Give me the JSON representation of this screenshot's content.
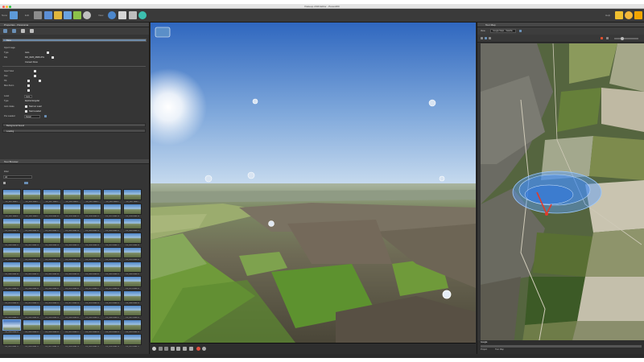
{
  "window": {
    "title": "Pasteup 2019 Editor - Panos360"
  },
  "toolbar": {
    "left_label": "Nano",
    "edit_label": "Edit",
    "view_label": "View",
    "right_label": "Help"
  },
  "properties": {
    "title": "Properties - Panorama",
    "name_value": "Base",
    "input_image_label": "Input Image",
    "type_label": "Type",
    "type_value": "Auto",
    "file_label": "File",
    "file_value": "DJI_0025_0808.JPG",
    "convert_label": "Convert Pano",
    "input_view_label": "Input View",
    "pan_label": "Pan",
    "tilt_label": "Tilt",
    "fov_label": "Max Zoom",
    "level_label": "Level",
    "level_value": "Auto",
    "type2_label": "Type",
    "type2_value": "Equirectangular",
    "auto_label": "Auto rotate",
    "startload": "Start on Load",
    "startnext": "Start Loaded",
    "overlay_label": "Pre Loaded",
    "overlay_value": "Detail",
    "section1": "Background Sound",
    "section2": "Loading"
  },
  "tour_browser": {
    "title": "Tour Browser",
    "filter_label": "Filter",
    "filter_value": "All",
    "thumbs": [
      "DJI_0025 Node 1",
      "DJI_0026 Node 2",
      "DJI_0027 Node 3",
      "DJI_0028 Node 4",
      "DJI_0029 Node 5",
      "DJI_0030 Node 6",
      "DJI_0031 Node 7",
      "DJI_0032 Node 8",
      "DJI_0033 Node 9",
      "DJI_0034 Node 10",
      "DJI_0035 Node 11",
      "DJI_0036 Node 12",
      "DJI_0037 Node 13",
      "DJI_0038 Node 14",
      "DJI_0039 Node 15",
      "DJI_0040 Node 16",
      "DJI_0041 Node 17",
      "DJI_0042 Node 18",
      "DJI_0043 Node 19",
      "DJI_0044 Node 20",
      "DJI_0045 Node 21",
      "DJI_0046 Node 22",
      "DJI_0047 Node 23",
      "DJI_0048 Node 24",
      "DJI_0049 Node 25",
      "DJI_0050 Node 26",
      "DJI_0051 Node 27",
      "DJI_0052 Node 28",
      "DJI_0053 Node 29",
      "DJI_0054 Node 30",
      "DJI_0055 Node 31",
      "DJI_0056 Node 32",
      "DJI_0057 Node 33",
      "DJI_0058 Node 34",
      "DJI_0059 Node 35",
      "DJI_0060 Node 36",
      "DJI_0061 Node 37",
      "DJI_0062 Node 38",
      "DJI_0063 Node 39",
      "DJI_0064 Node 40",
      "DJI_0065 Node 41",
      "DJI_0066 Node 42",
      "DJI_0067 Node 43",
      "DJI_0068 Node 44",
      "DJI_0069 Node 45",
      "DJI_0070 Node 46",
      "DJI_0071 Node 47",
      "DJI_0072 Node 48",
      "DJI_0073 Node 49",
      "DJI_0074 Node 50",
      "DJI_0075 Node 51",
      "DJI_0076 Node 52",
      "DJI_0077 Node 53",
      "DJI_0078 Node 54",
      "DJI_0079 Node 55",
      "DJI_0080 Node 56",
      "DJI_0081 Node 57",
      "DJI_0082 Node 58",
      "DJI_0083 Node 59",
      "DJI_0084 Node 60",
      "DJI_0085 Node 61",
      "DJI_0086 Node 62",
      "DJI_0087 Node 63",
      "DJI_0088 Node 64",
      "DJI_0089 Node 65",
      "DJI_0090 Node 66",
      "DJI_0091 Node 67",
      "DJI_0092 Node 68",
      "DJI_0093 Node 69",
      "DJI_0094 Node 70",
      "DJI_0095 Node 71",
      "DJI_0096 Node 72",
      "DJI_0097 Node 73",
      "DJI_0098 Node 74",
      "DJI_0099 Node 75",
      "DJI_0100 Node 76",
      "DJI_0101 Node 77"
    ]
  },
  "tour_map": {
    "title": "Tour Map",
    "view_label": "View",
    "view_value": "Google Maps - Satellite",
    "google_label": "Google",
    "footer_left": "Project",
    "footer_right": "Tour Map"
  },
  "colors": {
    "accent": "#6a8fb5",
    "sky_top": "#3b6fc0",
    "sky_bottom": "#c4d8ee",
    "hotspot": "#4d9dff"
  }
}
